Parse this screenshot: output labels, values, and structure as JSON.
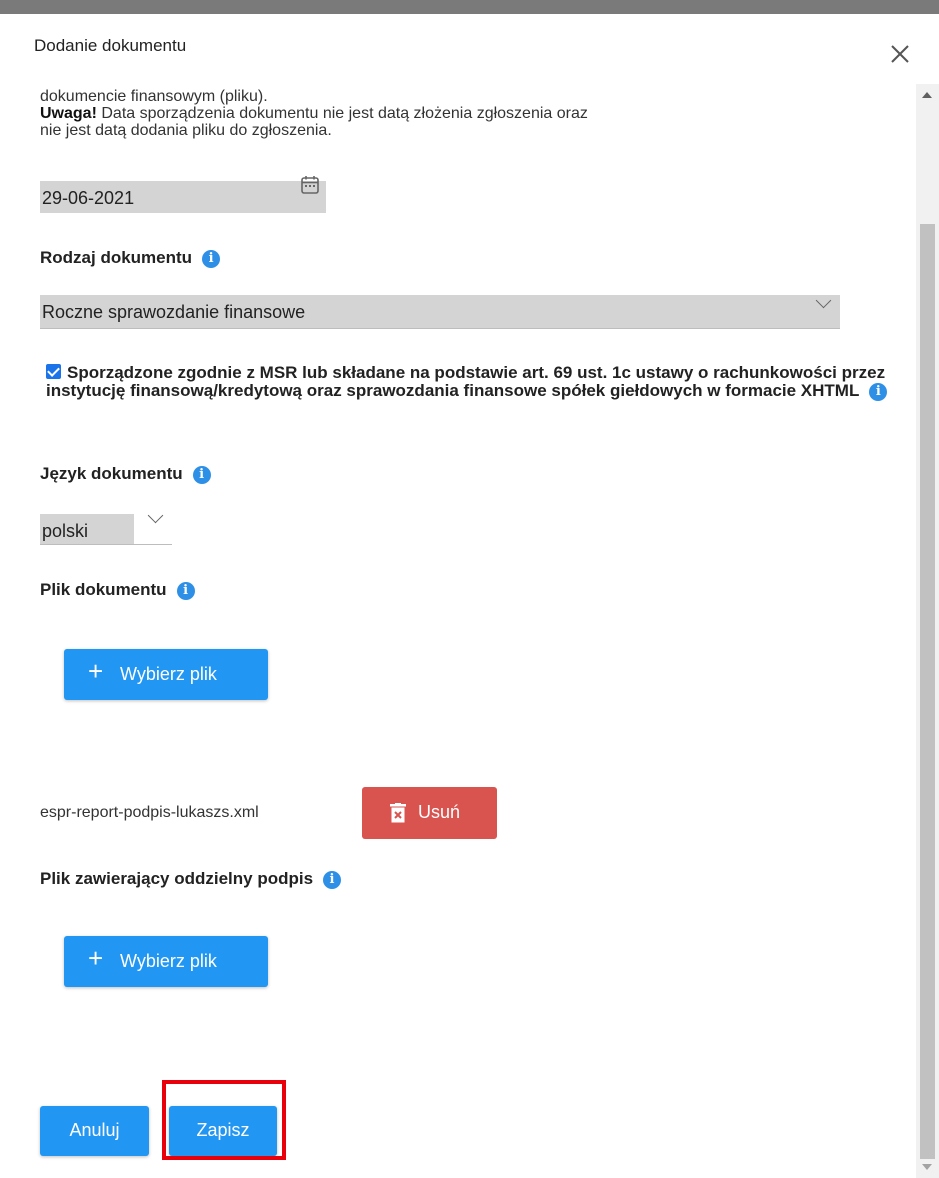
{
  "dialog": {
    "title": "Dodanie dokumentu",
    "close_icon": "close-icon"
  },
  "info": {
    "cut_line": "`  ˙  `  ˙  ˙  ˙",
    "line1": "dokumencie finansowym (pliku).",
    "warning_label": "Uwaga!",
    "warning_text": "Data sporządzenia dokumentu nie jest datą złożenia zgłoszenia oraz nie jest datą dodania pliku do zgłoszenia."
  },
  "date": {
    "value": "29-06-2021",
    "icon": "calendar-icon"
  },
  "document_type": {
    "label": "Rodzaj dokumentu",
    "selected": "Roczne sprawozdanie finansowe"
  },
  "msr_checkbox": {
    "checked": true,
    "label": "Sporządzone zgodnie z MSR lub składane na podstawie art. 69 ust. 1c ustawy o rachunkowości przez instytucję finansową/kredytową oraz sprawozdania finansowe spółek giełdowych w formacie XHTML"
  },
  "language": {
    "label": "Język dokumentu",
    "selected": "polski"
  },
  "document_file": {
    "label": "Plik dokumentu",
    "choose_label": "Wybierz plik",
    "file_name": "espr-report-podpis-lukaszs.xml",
    "remove_label": "Usuń"
  },
  "signature_file": {
    "label": "Plik zawierający oddzielny podpis",
    "choose_label": "Wybierz plik"
  },
  "footer": {
    "cancel_label": "Anuluj",
    "save_label": "Zapisz"
  },
  "colors": {
    "primary": "#2196f3",
    "danger": "#d9534f",
    "info_icon": "#2e8fe6",
    "highlight": "#e8000b"
  }
}
